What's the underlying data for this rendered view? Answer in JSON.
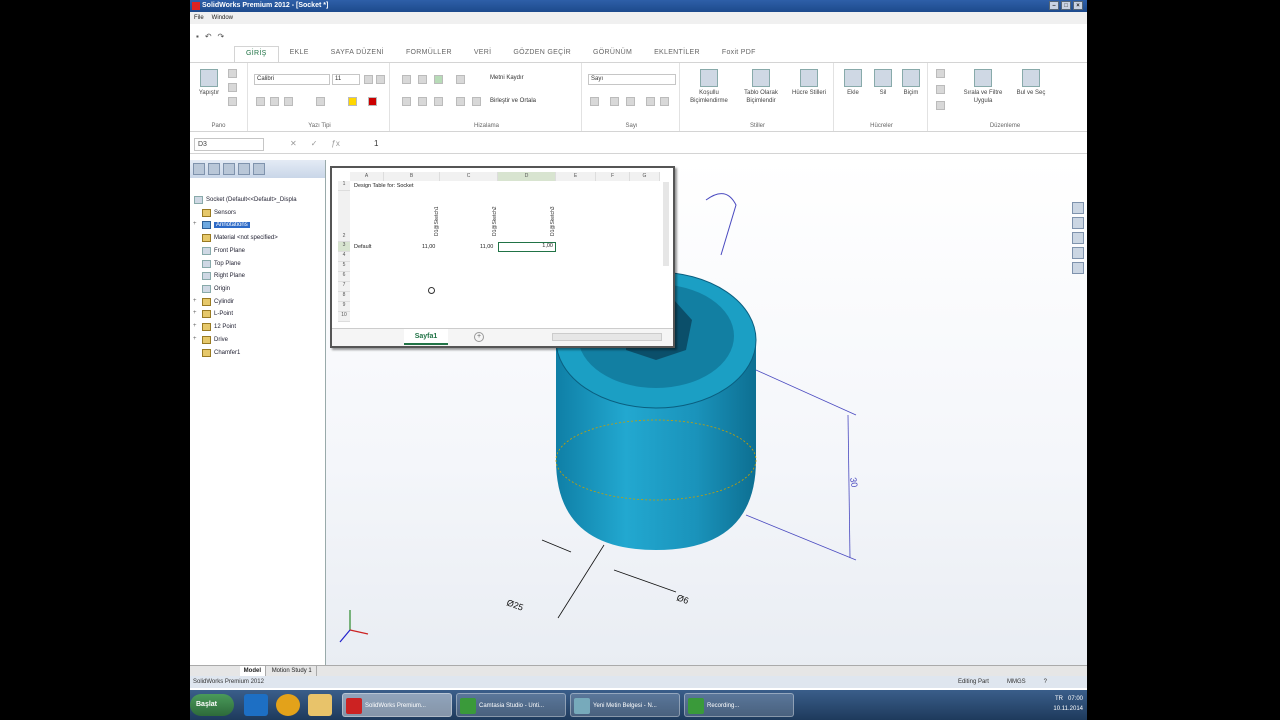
{
  "window": {
    "title": "SolidWorks Premium 2012 - [Socket *]"
  },
  "menu": [
    "File",
    "Window"
  ],
  "excel": {
    "tabs": [
      "GİRİŞ",
      "EKLE",
      "SAYFA DÜZENİ",
      "FORMÜLLER",
      "VERİ",
      "GÖZDEN GEÇİR",
      "GÖRÜNÜM",
      "EKLENTİLER",
      "Foxit PDF"
    ],
    "active_tab": "GİRİŞ",
    "font_name": "Calibri",
    "font_size": "11",
    "number_format": "Sayı",
    "merge_label": "Birleştir ve Ortala",
    "wrap_label": "Metni Kaydır",
    "groups": [
      "Pano",
      "Yazı Tipi",
      "Hizalama",
      "Sayı",
      "Stiller",
      "Hücreler",
      "Düzenleme"
    ],
    "styles_buttons": [
      "Koşullu Biçimlendirme",
      "Tablo Olarak Biçimlendir",
      "Hücre Stilleri"
    ],
    "cells_buttons": [
      "Ekle",
      "Sil",
      "Biçim"
    ],
    "edit_buttons": [
      "Sırala ve Filtre Uygula",
      "Bul ve Seç"
    ],
    "paste_label": "Yapıştır",
    "name_box": "D3",
    "formula_value": "1",
    "sheet_tab": "Sayfa1"
  },
  "sheet": {
    "columns": [
      "A",
      "B",
      "C",
      "D",
      "E",
      "F",
      "G"
    ],
    "rows": [
      "1",
      "2",
      "3",
      "4",
      "5",
      "6",
      "7",
      "8",
      "9",
      "10"
    ],
    "title_cell": "Design Table for: Socket",
    "row3": {
      "label": "Default",
      "b": "11,00",
      "c": "11,00",
      "d": "1,00"
    },
    "vertical_headers": [
      "D1@Sketch1",
      "D1@Sketch2",
      "D1@Sketch3"
    ]
  },
  "tree": {
    "root": "Socket (Default<<Default>_Displa",
    "items": [
      "Sensors",
      "Annotations",
      "Material <not specified>",
      "Front Plane",
      "Top Plane",
      "Right Plane",
      "Origin",
      "Cylindir",
      "L-Point",
      "12 Point",
      "Drive",
      "Chamfer1"
    ]
  },
  "bottom_tabs": [
    "Model",
    "Motion Study 1"
  ],
  "status": {
    "app": "SolidWorks Premium 2012",
    "mode": "Editing Part",
    "units": "MMGS"
  },
  "dimensions": {
    "dia_outer": "Ø25",
    "dia_inner": "Ø6",
    "height": "30"
  },
  "taskbar": {
    "start": "Başlat",
    "apps": [
      "SolidWorks Premium...",
      "Camtasia Studio - Unti...",
      "Yeni Metin Belgesi - N...",
      "Recording..."
    ],
    "lang": "TR",
    "time": "07:00",
    "date": "10.11.2014"
  },
  "colors": {
    "part": "#1b9fc4",
    "excel_green": "#217346",
    "title": "#2e5fa8"
  }
}
